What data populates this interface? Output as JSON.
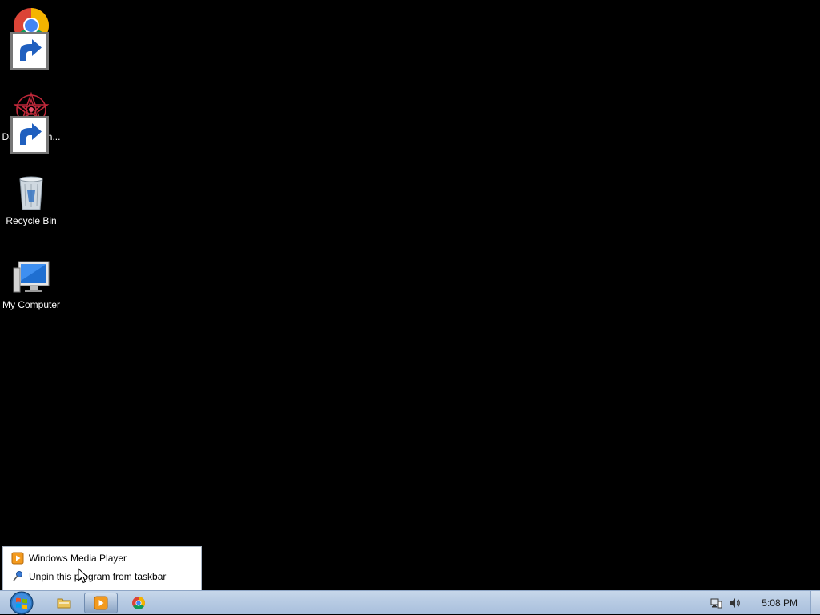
{
  "desktop": {
    "icons": [
      {
        "label": "Google Chrome",
        "icon": "chrome-icon"
      },
      {
        "label": "DataWagon...",
        "icon": "datawagon-icon"
      },
      {
        "label": "Recycle Bin",
        "icon": "recycle-bin-icon"
      },
      {
        "label": "My Computer",
        "icon": "my-computer-icon"
      }
    ]
  },
  "jumplist": {
    "items": [
      {
        "label": "Windows Media Player",
        "icon": "media-player-icon"
      },
      {
        "label": "Unpin this program from taskbar",
        "icon": "unpin-icon"
      }
    ]
  },
  "taskbar": {
    "pinned": [
      {
        "name": "windows-explorer",
        "icon": "folder-icon"
      },
      {
        "name": "windows-media-player",
        "icon": "media-player-icon",
        "active": true
      },
      {
        "name": "google-chrome",
        "icon": "chrome-icon"
      }
    ],
    "tray": {
      "icons": [
        "network-icon",
        "volume-icon"
      ],
      "clock": "5:08 PM"
    }
  },
  "colors": {
    "taskbar_top": "#c7d7ea",
    "taskbar_bottom": "#a9bfdc",
    "desktop_background": "#000000",
    "jumplist_border": "#a9b5c4"
  }
}
